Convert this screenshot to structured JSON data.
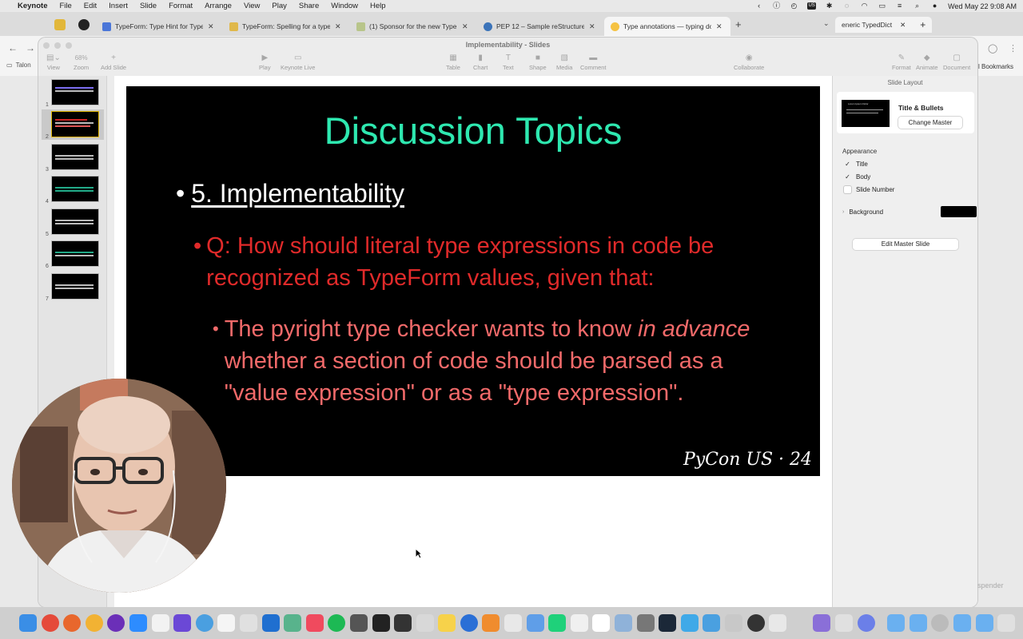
{
  "menubar": {
    "app": "Keynote",
    "items": [
      "File",
      "Edit",
      "Insert",
      "Slide",
      "Format",
      "Arrange",
      "View",
      "Play",
      "Share",
      "Window",
      "Help"
    ],
    "clock": "Wed May 22  9:08 AM"
  },
  "tabs": [
    {
      "title": "TypeForm: Type Hint for Type",
      "color": "#4a76d8"
    },
    {
      "title": "TypeForm: Spelling for a type",
      "color": "#e0b84a"
    },
    {
      "title": "(1) Sponsor for the new TypeF",
      "color": "#b8c58a"
    },
    {
      "title": "PEP 12 – Sample reStructure",
      "color": "#3b73b9"
    },
    {
      "title": "Type annotations — typing do",
      "color": "#f5c242"
    }
  ],
  "right_tab": {
    "title": "eneric TypedDict"
  },
  "browser": {
    "bookmark_folder": "Talon",
    "bookmarks_label": "ll Bookmarks"
  },
  "keynote": {
    "window_title": "Implementability - Slides",
    "toolbar": {
      "view": "View",
      "zoom": "Zoom",
      "zoom_value": "68%",
      "add_slide": "Add Slide",
      "play": "Play",
      "keynote_live": "Keynote Live",
      "table": "Table",
      "chart": "Chart",
      "text": "Text",
      "shape": "Shape",
      "media": "Media",
      "comment": "Comment",
      "collaborate": "Collaborate",
      "format": "Format",
      "animate": "Animate",
      "document": "Document"
    },
    "slide_numbers": [
      "1",
      "2",
      "3",
      "4",
      "5",
      "6",
      "7"
    ],
    "selected_slide": 2
  },
  "slide": {
    "title": "Discussion Topics",
    "bullet1": "5. Implementability",
    "bullet2": "Q: How should literal type expressions in code be recognized as TypeForm values, given that:",
    "bullet3_pre": "The pyright type checker wants to know ",
    "bullet3_em": "in advance",
    "bullet3_post": " whether a section of code should be parsed as a \"value expression\" or as a \"type expression\".",
    "footer": "PyCon US · 24",
    "colors": {
      "title": "#2ee8b0",
      "bullet2": "#e02a2a",
      "bullet3": "#f26a6a"
    }
  },
  "inspector": {
    "heading": "Slide Layout",
    "layout_name": "Title & Bullets",
    "change_master": "Change Master",
    "thumb_text": "Lorem Ipsum Dolor",
    "appearance": "Appearance",
    "options": [
      {
        "label": "Title",
        "checked": true
      },
      {
        "label": "Body",
        "checked": true
      },
      {
        "label": "Slide Number",
        "checked": false
      }
    ],
    "background_label": "Background",
    "background_color": "#000000",
    "edit_master": "Edit Master Slide"
  },
  "misc": {
    "spender": "spender"
  }
}
